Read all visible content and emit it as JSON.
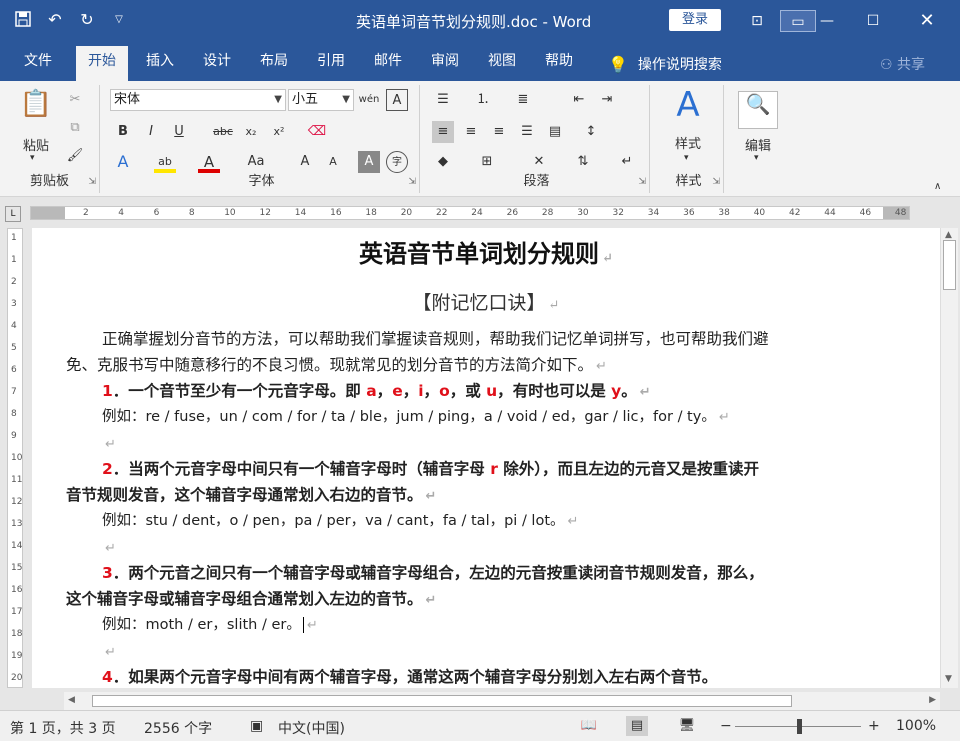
{
  "title_bar": {
    "document_title": "英语单词音节划分规则.doc  -  Word",
    "login_label": "登录",
    "qat_icons": [
      "save-icon",
      "undo-icon",
      "redo-icon",
      "customize-icon"
    ]
  },
  "menu": {
    "tabs": [
      "文件",
      "开始",
      "插入",
      "设计",
      "布局",
      "引用",
      "邮件",
      "审阅",
      "视图",
      "帮助"
    ],
    "active": "开始",
    "tell_me": "操作说明搜索",
    "share": "共享"
  },
  "ribbon": {
    "clipboard": {
      "label": "剪贴板",
      "paste": "粘贴"
    },
    "font": {
      "label": "字体",
      "font_name": "宋体",
      "font_size": "小五"
    },
    "paragraph": {
      "label": "段落"
    },
    "styles": {
      "label": "样式",
      "button": "样式"
    },
    "editing": {
      "button": "编辑"
    }
  },
  "ruler": {
    "ticks": [
      "2",
      "4",
      "6",
      "8",
      "10",
      "12",
      "14",
      "16",
      "18",
      "20",
      "22",
      "24",
      "26",
      "28",
      "30",
      "32",
      "34",
      "36",
      "38",
      "40",
      "42",
      "44",
      "46",
      "48"
    ]
  },
  "vruler_ticks": [
    "1",
    "1",
    "2",
    "3",
    "4",
    "5",
    "6",
    "7",
    "8",
    "9",
    "10",
    "11",
    "12",
    "13",
    "14",
    "15",
    "16",
    "17",
    "18",
    "19",
    "20"
  ],
  "document": {
    "title": "英语音节单词划分规则",
    "subtitle": "【附记忆口诀】",
    "intro_line1": "正确掌握划分音节的方法，可以帮助我们掌握读音规则，帮助我们记忆单词拼写，也可帮助我们避",
    "intro_line2": "免、克服书写中随意移行的不良习惯。现就常见的划分音节的方法简介如下。",
    "rule1": {
      "num": "1",
      "text_a": "．一个音节至少有一个元音字母。即 ",
      "vowels": [
        "a",
        "e",
        "i",
        "o",
        "u"
      ],
      "text_b": "有时也可以是 ",
      "y": "y",
      "end": "。",
      "example": "例如：re / fuse，un / com / for / ta / ble，jum / ping，a / void / ed，gar / lic，for / ty。"
    },
    "rule2": {
      "num": "2",
      "text_a": "．当两个元音字母中间只有一个辅音字母时（辅音字母 ",
      "r": "r",
      "text_b": " 除外），而且左边的元音又是按重读开",
      "line2": "音节规则发音，这个辅音字母通常划入右边的音节。",
      "example": "例如：stu / dent，o / pen，pa / per，va / cant，fa / tal，pi / lot。"
    },
    "rule3": {
      "num": "3",
      "line1": "．两个元音之间只有一个辅音字母或辅音字母组合，左边的元音按重读闭音节规则发音，那么，",
      "line2": "这个辅音字母或辅音字母组合通常划入左边的音节。",
      "example": "例如：moth / er，slith / er。"
    },
    "rule4": {
      "num": "4",
      "line1": "．如果两个元音字母中间有两个辅音字母，通常这两个辅音字母分别划入左右两个音节。"
    }
  },
  "status": {
    "page_info": "第 1 页，共 3 页",
    "word_count": "2556 个字",
    "language": "中文(中国)",
    "zoom": "100%",
    "zoom_minus": "−",
    "zoom_plus": "+"
  }
}
